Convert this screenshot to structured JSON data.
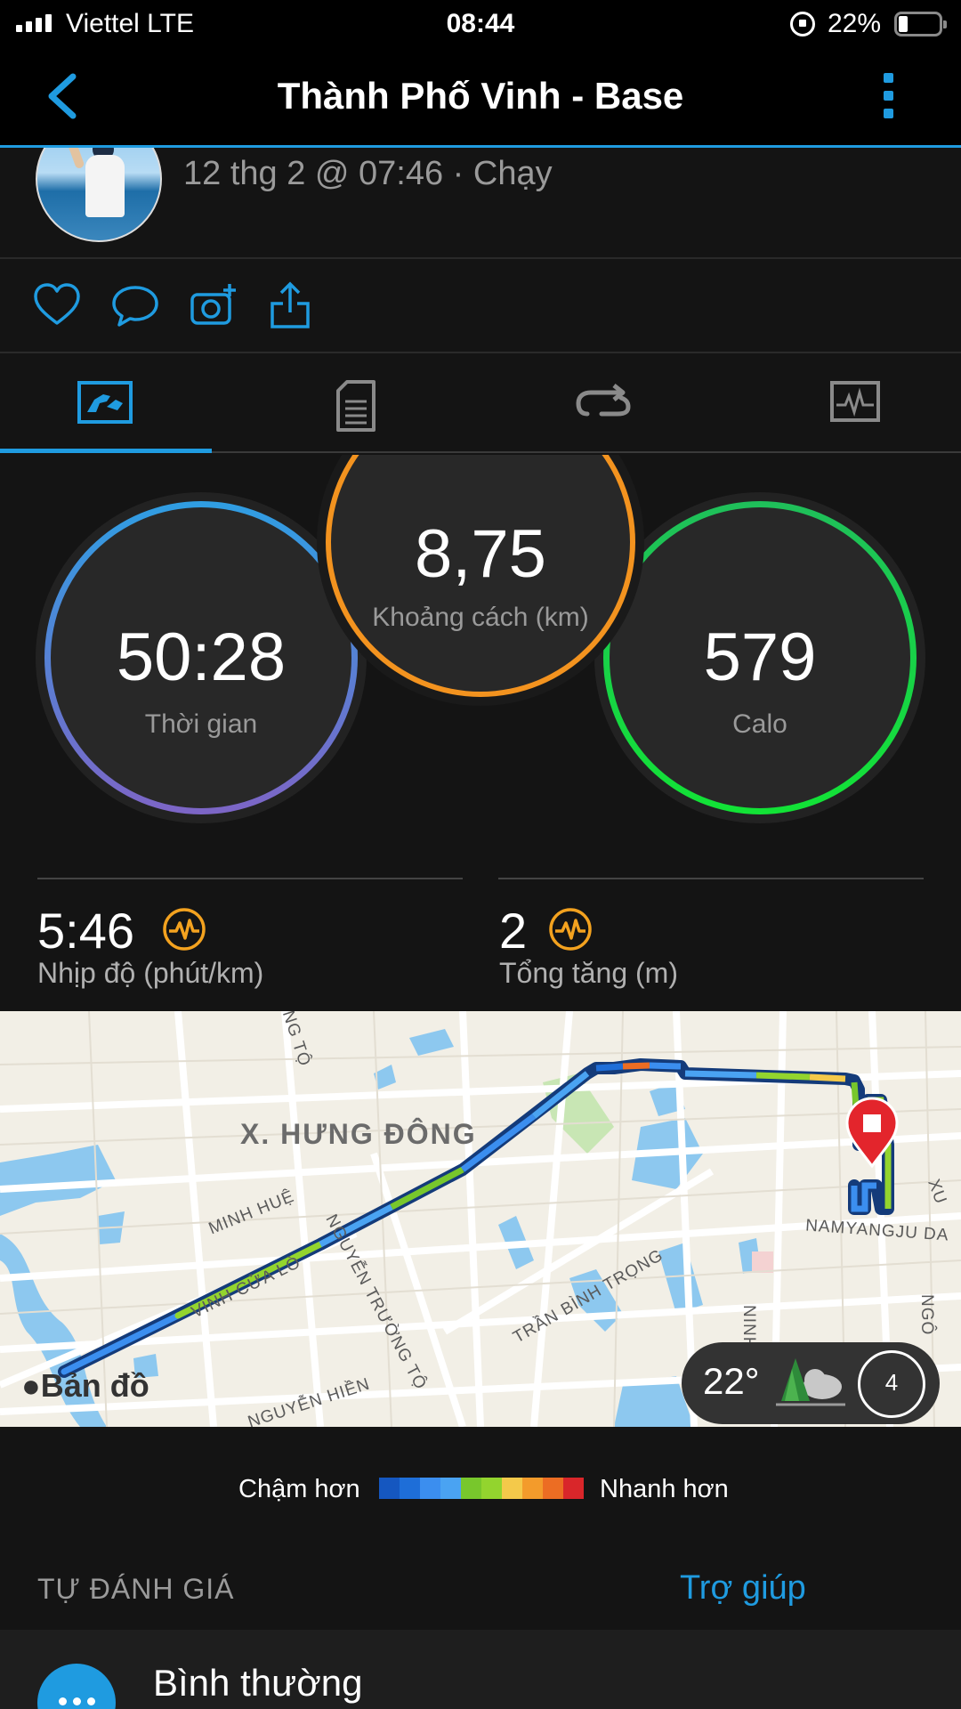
{
  "status_bar": {
    "carrier": "Viettel   LTE",
    "time": "08:44",
    "battery": "22%"
  },
  "header": {
    "title": "Thành Phố Vinh - Base"
  },
  "activity": {
    "meta": "12 thg 2 @ 07:46 · Chạy"
  },
  "tabs": [
    {
      "name": "summary",
      "active": true
    },
    {
      "name": "details",
      "active": false
    },
    {
      "name": "laps",
      "active": false
    },
    {
      "name": "charts",
      "active": false
    }
  ],
  "stats": {
    "time": {
      "value": "50:28",
      "label": "Thời gian"
    },
    "distance": {
      "value": "8,75",
      "label": "Khoảng cách (km)"
    },
    "calories": {
      "value": "579",
      "label": "Calo"
    },
    "pace": {
      "value": "5:46",
      "label": "Nhịp độ (phút/km)"
    },
    "elevation": {
      "value": "2",
      "label": "Tổng tăng (m)"
    }
  },
  "map": {
    "district": "X. HƯNG ĐÔNG",
    "streets": [
      "NG TỘ",
      "MINH HUỆ",
      "VINH CỬA LÒ",
      "NGUYỄN TRƯỜNG TỘ",
      "TRẦN BÌNH TRỌNG",
      "NAMYANGJU DA",
      "NGUYỄN HIỀN",
      "NINH",
      "NGÔ",
      "XU"
    ],
    "attribution": "Bản đồ",
    "temperature": "22°",
    "compass": "4"
  },
  "legend": {
    "slow": "Chậm hơn",
    "fast": "Nhanh hơn",
    "colors": [
      "#1557c0",
      "#1e6ed8",
      "#3b8eef",
      "#4aa3f2",
      "#78c72c",
      "#93d42e",
      "#f4c94a",
      "#f39b2b",
      "#ec6d23",
      "#d9262a"
    ]
  },
  "self_eval": {
    "title": "TỰ ĐÁNH GIÁ",
    "help": "Trợ giúp",
    "feeling": "Bình thường"
  },
  "colors": {
    "accent": "#1f9be0",
    "time_ring": "#3d8ed8",
    "distance_ring": "#f3931f",
    "calorie_ring": "#1ddb45",
    "hr_icon": "#f3a21f"
  }
}
